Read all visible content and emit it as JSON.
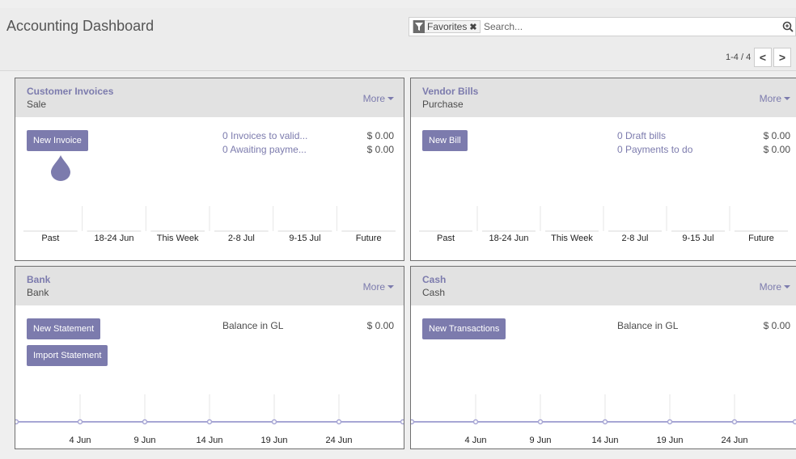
{
  "header": {
    "title": "Accounting Dashboard",
    "facet_label": "Favorites",
    "search_placeholder": "Search...",
    "pager_value": "1-4 / 4",
    "pager_prev": "<",
    "pager_next": ">"
  },
  "cards": {
    "customer_invoices": {
      "title": "Customer Invoices",
      "type": "Sale",
      "more": "More",
      "button": "New Invoice",
      "stats": [
        {
          "label": "0 Invoices to valid...",
          "amount": "$ 0.00"
        },
        {
          "label": "0 Awaiting payme...",
          "amount": "$ 0.00"
        }
      ],
      "graph_type": "bar",
      "graph_labels": [
        "Past",
        "18-24 Jun",
        "This Week",
        "2-8 Jul",
        "9-15 Jul",
        "Future"
      ]
    },
    "vendor_bills": {
      "title": "Vendor Bills",
      "type": "Purchase",
      "more": "More",
      "button": "New Bill",
      "stats": [
        {
          "label": "0 Draft bills",
          "amount": "$ 0.00"
        },
        {
          "label": "0 Payments to do",
          "amount": "$ 0.00"
        }
      ],
      "graph_type": "bar",
      "graph_labels": [
        "Past",
        "18-24 Jun",
        "This Week",
        "2-8 Jul",
        "9-15 Jul",
        "Future"
      ]
    },
    "bank": {
      "title": "Bank",
      "type": "Bank",
      "more": "More",
      "buttons": [
        "New Statement",
        "Import Statement"
      ],
      "balance_label": "Balance in GL",
      "balance_amount": "$ 0.00",
      "graph_type": "line",
      "graph_labels": [
        "4 Jun",
        "9 Jun",
        "14 Jun",
        "19 Jun",
        "24 Jun"
      ]
    },
    "cash": {
      "title": "Cash",
      "type": "Cash",
      "more": "More",
      "button": "New Transactions",
      "balance_label": "Balance in GL",
      "balance_amount": "$ 0.00",
      "graph_type": "line",
      "graph_labels": [
        "4 Jun",
        "9 Jun",
        "14 Jun",
        "19 Jun",
        "24 Jun"
      ]
    }
  },
  "colors": {
    "accent": "#7c7bad",
    "header_bg": "#e2e2e2",
    "line": "#a7a6d4"
  }
}
